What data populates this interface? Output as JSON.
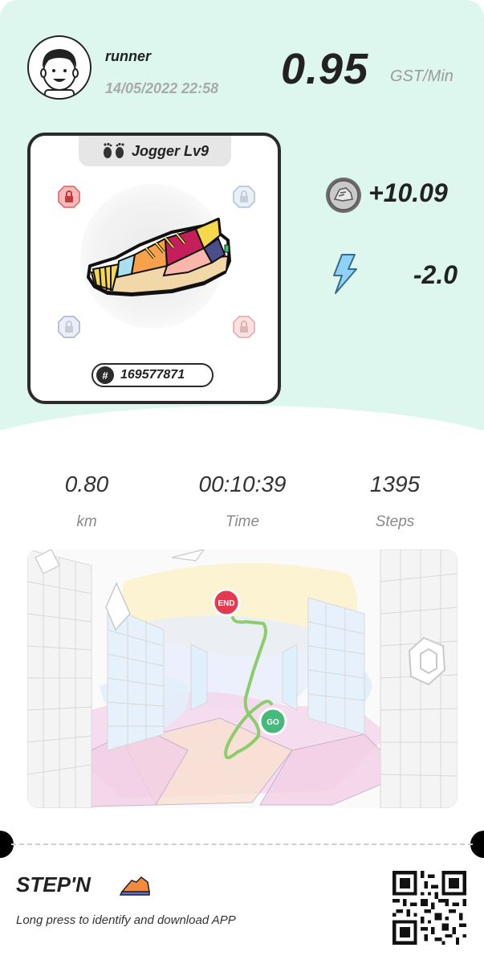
{
  "header": {
    "username": "runner",
    "datetime": "14/05/2022 22:58",
    "rate_value": "0.95",
    "rate_unit": "GST/Min"
  },
  "shoe": {
    "tier_label": "Jogger Lv9",
    "id": "169577871",
    "socket_icons": [
      "lock-red-icon",
      "lock-blue-icon",
      "lock-blue-icon",
      "lock-red-icon"
    ]
  },
  "earnings": {
    "gst": "+10.09",
    "energy": "-2.0"
  },
  "stats": [
    {
      "value": "0.80",
      "label": "km"
    },
    {
      "value": "00:10:39",
      "label": "Time"
    },
    {
      "value": "1395",
      "label": "Steps"
    }
  ],
  "map": {
    "end_label": "END",
    "go_label": "GO",
    "route_color": "#8ccc6a"
  },
  "footer": {
    "brand": "STEP'N",
    "promo": "Long press to identify and download APP"
  },
  "colors": {
    "mint": "#ddf7ef",
    "end_marker": "#e23a50",
    "go_marker": "#48b97c"
  }
}
